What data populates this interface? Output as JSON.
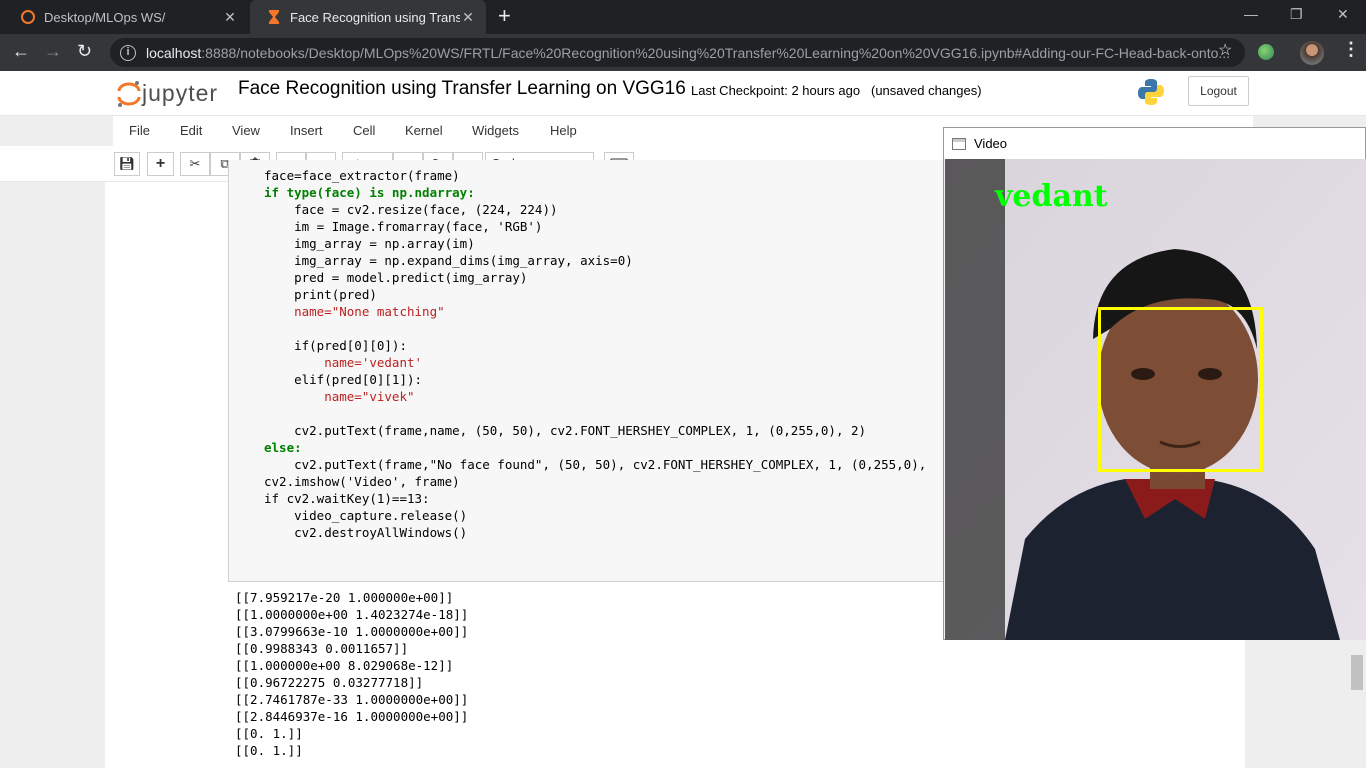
{
  "browser": {
    "tabs": [
      {
        "title": "Desktop/MLOps WS/",
        "active": false
      },
      {
        "title": "Face Recognition using Transfer L",
        "active": true
      }
    ],
    "url_host": "localhost",
    "url_path": ":8888/notebooks/Desktop/MLOps%20WS/FRTL/Face%20Recognition%20using%20Transfer%20Learning%20on%20VGG16.ipynb#Adding-our-FC-Head-back-onto..."
  },
  "header": {
    "logo_text": "jupyter",
    "notebook_title": "Face Recognition using Transfer Learning on VGG16",
    "checkpoint": "Last Checkpoint: 2 hours ago",
    "unsaved": "(unsaved changes)",
    "logout_label": "Logout"
  },
  "menu": [
    "File",
    "Edit",
    "View",
    "Insert",
    "Cell",
    "Kernel",
    "Widgets",
    "Help"
  ],
  "toolbar": {
    "run_label": "Run",
    "cell_type": "Code"
  },
  "code_lines": [
    "face=face_extractor(frame)",
    "if type(face) is np.ndarray:",
    "    face = cv2.resize(face, (224, 224))",
    "    im = Image.fromarray(face, 'RGB')",
    "    img_array = np.array(im)",
    "    img_array = np.expand_dims(img_array, axis=0)",
    "    pred = model.predict(img_array)",
    "    print(pred)",
    "    name=\"None matching\"",
    "",
    "    if(pred[0][0]):",
    "        name='vedant'",
    "    elif(pred[0][1]):",
    "        name=\"vivek\"",
    "",
    "    cv2.putText(frame,name, (50, 50), cv2.FONT_HERSHEY_COMPLEX, 1, (0,255,0), 2)",
    "else:",
    "    cv2.putText(frame,\"No face found\", (50, 50), cv2.FONT_HERSHEY_COMPLEX, 1, (0,255,0),",
    "cv2.imshow('Video', frame)",
    "if cv2.waitKey(1)==13:",
    "    video_capture.release()",
    "    cv2.destroyAllWindows()"
  ],
  "output_lines": [
    "[[7.959217e-20 1.000000e+00]]",
    "[[1.0000000e+00 1.4023274e-18]]",
    "[[3.0799663e-10 1.0000000e+00]]",
    "[[0.9988343 0.0011657]]",
    "[[1.000000e+00 8.029068e-12]]",
    "[[0.96722275 0.03277718]]",
    "[[2.7461787e-33 1.0000000e+00]]",
    "[[2.8446937e-16 1.0000000e+00]]",
    "[[0. 1.]]",
    "[[0. 1.]]"
  ],
  "video_window": {
    "title": "Video",
    "caption": "vedant"
  },
  "colors": {
    "caption": "#00ff00",
    "face_box": "#ffff00"
  }
}
